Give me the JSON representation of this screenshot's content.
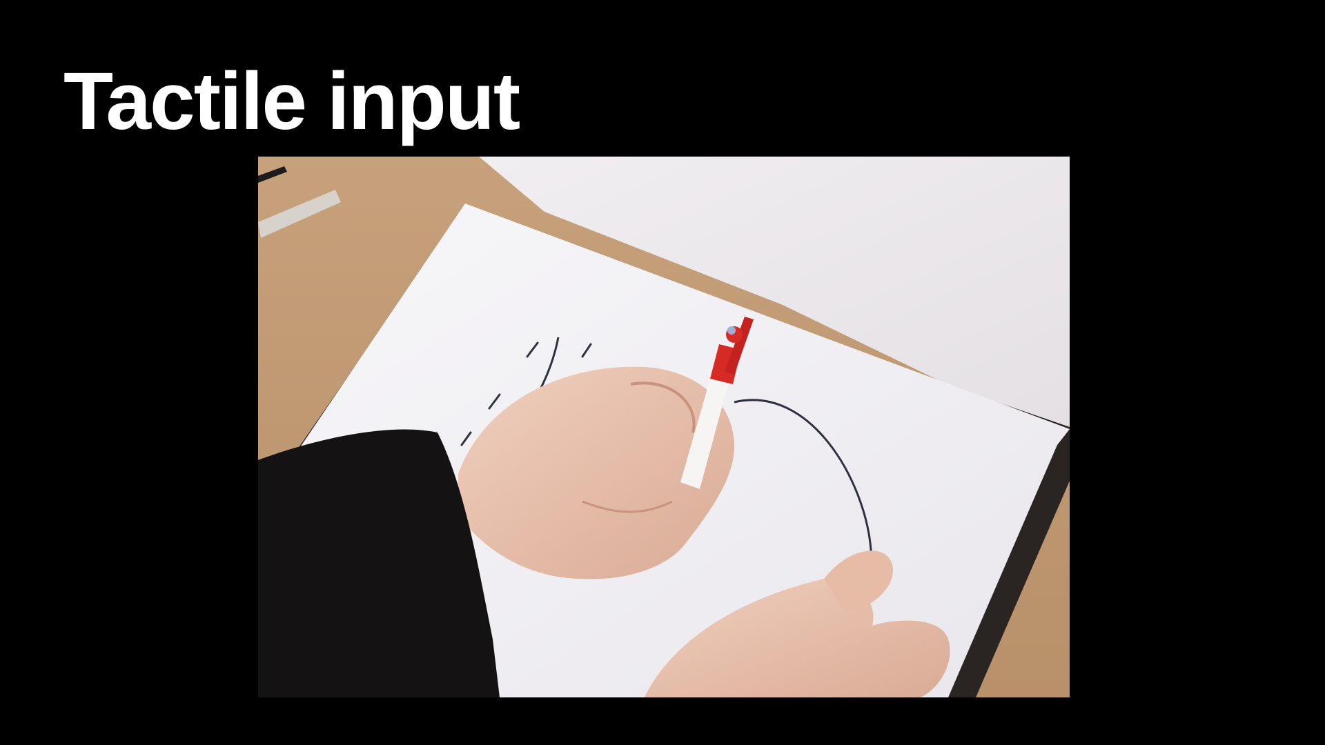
{
  "slide": {
    "title": "Tactile input"
  },
  "photo": {
    "icon": "drawing-photo",
    "colors": {
      "table": "#c9a783",
      "board": "#2a2522",
      "paper": "#f3f2f6",
      "tablecloth": "#ece9ed",
      "skin": "#e7c3b0",
      "sleeve": "#141212",
      "pen_body": "#f7f4f4",
      "pen_cap": "#d62a25",
      "ink": "#2d3142"
    }
  }
}
